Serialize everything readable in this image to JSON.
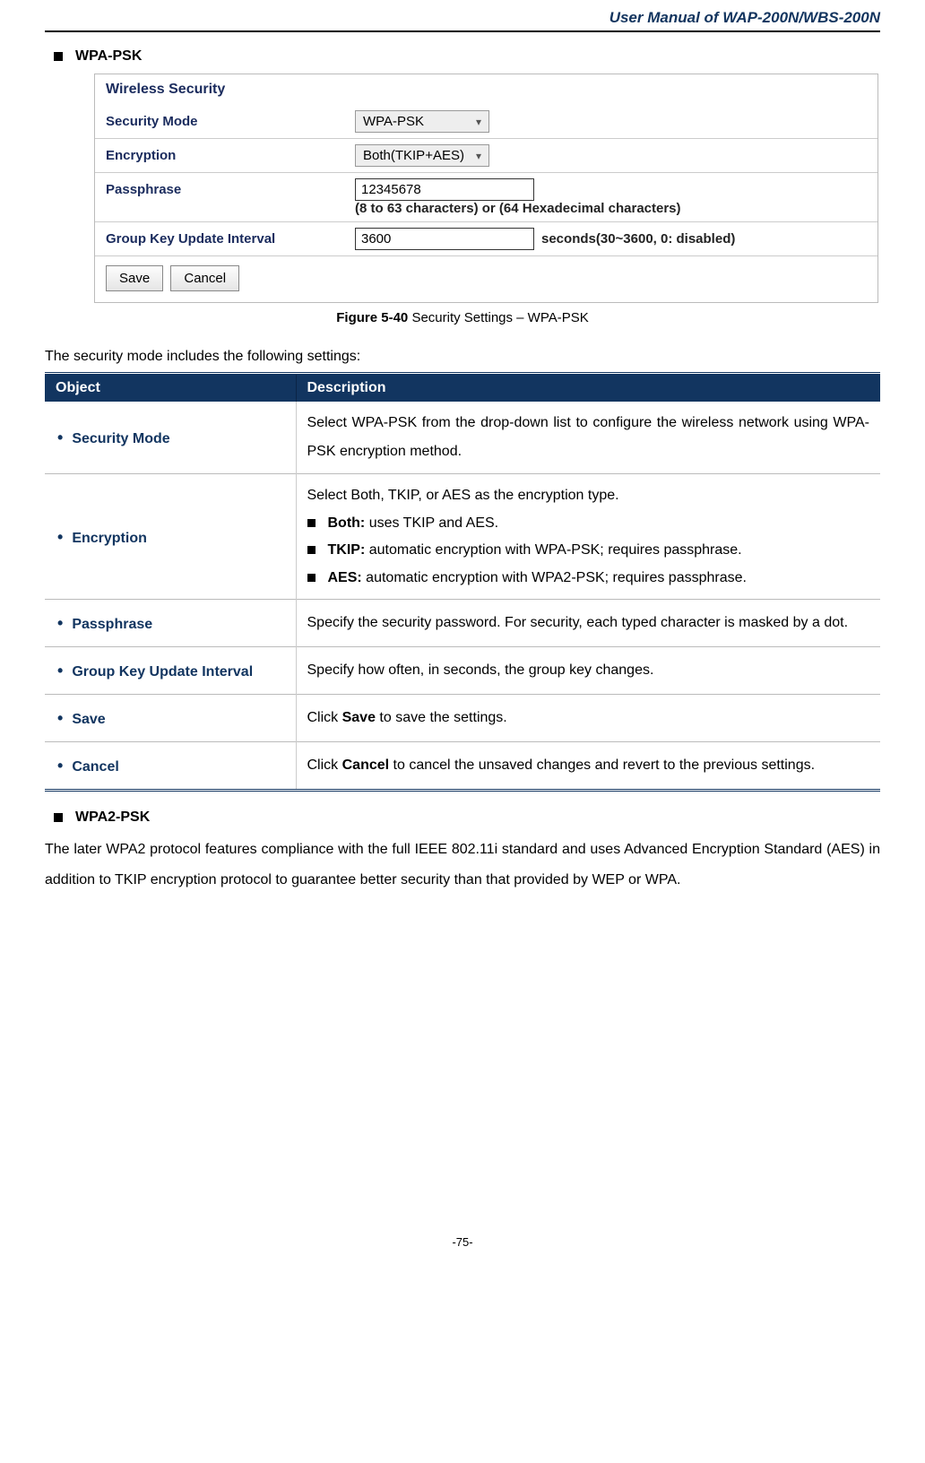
{
  "header": {
    "title": "User Manual of WAP-200N/WBS-200N"
  },
  "section1": {
    "heading": "WPA-PSK"
  },
  "screenshot": {
    "title": "Wireless Security",
    "security_mode": {
      "label": "Security Mode",
      "value": "WPA-PSK"
    },
    "encryption": {
      "label": "Encryption",
      "value": "Both(TKIP+AES)"
    },
    "passphrase": {
      "label": "Passphrase",
      "value": "12345678",
      "hint": "(8 to 63 characters) or (64 Hexadecimal characters)"
    },
    "group_key": {
      "label": "Group Key Update Interval",
      "value": "3600",
      "suffix": "seconds(30~3600, 0: disabled)"
    },
    "save": "Save",
    "cancel": "Cancel"
  },
  "caption": {
    "bold": "Figure 5-40",
    "rest": " Security Settings – WPA-PSK"
  },
  "intro": "The security mode includes the following settings:",
  "table": {
    "header_object": "Object",
    "header_description": "Description",
    "rows": {
      "security_mode": {
        "obj": "Security Mode",
        "desc": "Select WPA-PSK from the drop-down list to configure the wireless network using WPA-PSK encryption method."
      },
      "encryption": {
        "obj": "Encryption",
        "lead": "Select Both, TKIP, or AES as the encryption type.",
        "both_label": "Both:",
        "both_text": " uses TKIP and AES.",
        "tkip_label": "TKIP:",
        "tkip_text": " automatic encryption with WPA-PSK; requires passphrase.",
        "aes_label": "AES:",
        "aes_text": " automatic encryption with WPA2-PSK; requires passphrase."
      },
      "passphrase": {
        "obj": "Passphrase",
        "desc": "Specify the security password. For security, each typed character is masked by a dot."
      },
      "group_key": {
        "obj": "Group Key Update Interval",
        "desc": "Specify how often, in seconds, the group key changes."
      },
      "save": {
        "obj": "Save",
        "pre": "Click ",
        "bold": "Save",
        "post": " to save the settings."
      },
      "cancel": {
        "obj": "Cancel",
        "pre": "Click ",
        "bold": "Cancel",
        "post": " to cancel the unsaved changes and revert to the previous settings."
      }
    }
  },
  "section2": {
    "heading": "WPA2-PSK",
    "paragraph": "The later WPA2 protocol features compliance with the full IEEE 802.11i standard and uses Advanced Encryption Standard (AES) in addition to TKIP encryption protocol to guarantee better security than that provided by WEP or WPA."
  },
  "page_number": "-75-"
}
